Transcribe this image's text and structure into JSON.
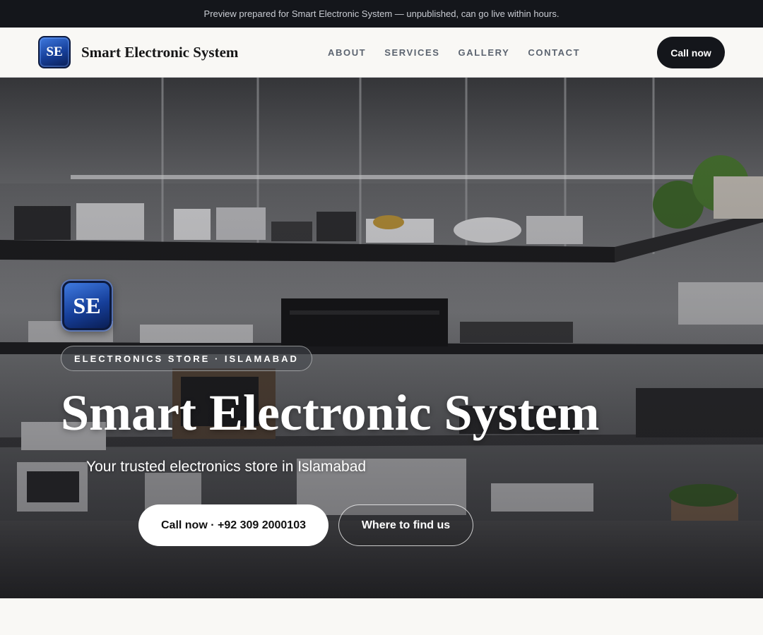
{
  "banner": {
    "text": "Preview prepared for Smart Electronic System — unpublished, can go live within hours."
  },
  "header": {
    "logo_text": "SE",
    "brand_name": "Smart Electronic System",
    "nav": [
      {
        "label": "ABOUT"
      },
      {
        "label": "SERVICES"
      },
      {
        "label": "GALLERY"
      },
      {
        "label": "CONTACT"
      }
    ],
    "cta_label": "Call now"
  },
  "hero": {
    "logo_text": "SE",
    "eyebrow": "ELECTRONICS STORE · ISLAMABAD",
    "title": "Smart Electronic System",
    "subtitle": "Your trusted electronics store in Islamabad",
    "primary_button": "Call now · +92 309 2000103",
    "secondary_button": "Where to find us",
    "background_image": "electronics store shelves with appliances"
  },
  "colors": {
    "banner_bg": "#14161b",
    "accent_dark": "#14161b",
    "logo_blue": "#163f9a",
    "page_bg": "#f9f8f5"
  }
}
